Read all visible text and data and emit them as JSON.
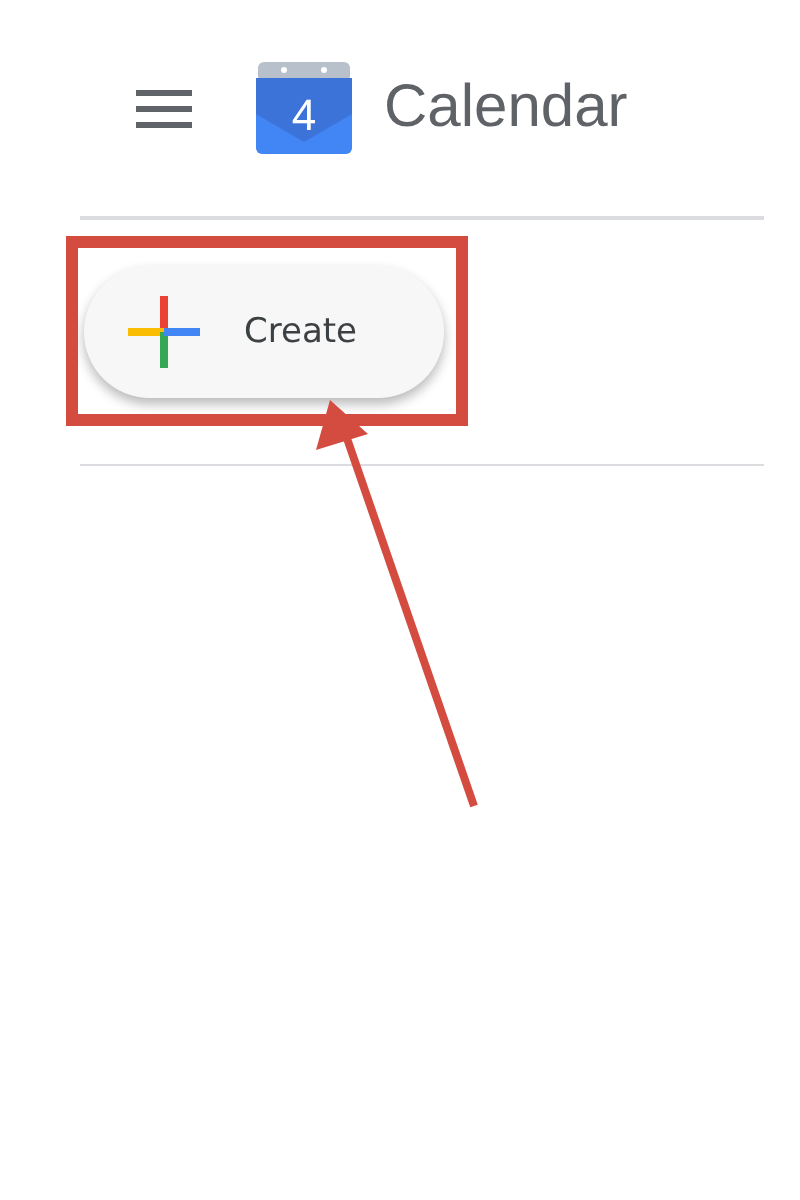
{
  "header": {
    "logo_day": "4",
    "title": "Calendar"
  },
  "create_button": {
    "label": "Create",
    "highlighted": true
  }
}
